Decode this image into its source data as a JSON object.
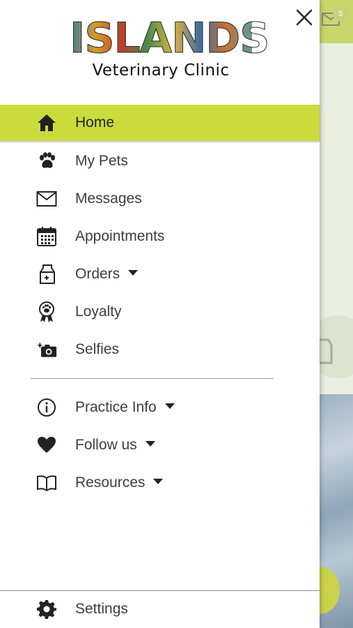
{
  "brand": {
    "title": "ISLANDS",
    "subtitle": "Veterinary Clinic"
  },
  "background": {
    "badge_count": "5"
  },
  "menu": {
    "primary": [
      {
        "label": "Home",
        "icon": "home-icon",
        "active": true
      },
      {
        "label": "My Pets",
        "icon": "paw-icon"
      },
      {
        "label": "Messages",
        "icon": "envelope-icon"
      },
      {
        "label": "Appointments",
        "icon": "calendar-icon"
      },
      {
        "label": "Orders",
        "icon": "pet-food-bag-icon",
        "dropdown": true
      },
      {
        "label": "Loyalty",
        "icon": "paw-award-ribbon-icon"
      },
      {
        "label": "Selfies",
        "icon": "camera-sparkle-icon"
      }
    ],
    "secondary": [
      {
        "label": "Practice Info",
        "icon": "info-icon",
        "dropdown": true
      },
      {
        "label": "Follow us",
        "icon": "heart-icon",
        "dropdown": true
      },
      {
        "label": "Resources",
        "icon": "book-icon",
        "dropdown": true
      }
    ],
    "settings": {
      "label": "Settings",
      "icon": "gear-icon"
    }
  },
  "colors": {
    "accent": "#cbdb3c",
    "text": "#3d3d3d",
    "icon": "#222222"
  }
}
